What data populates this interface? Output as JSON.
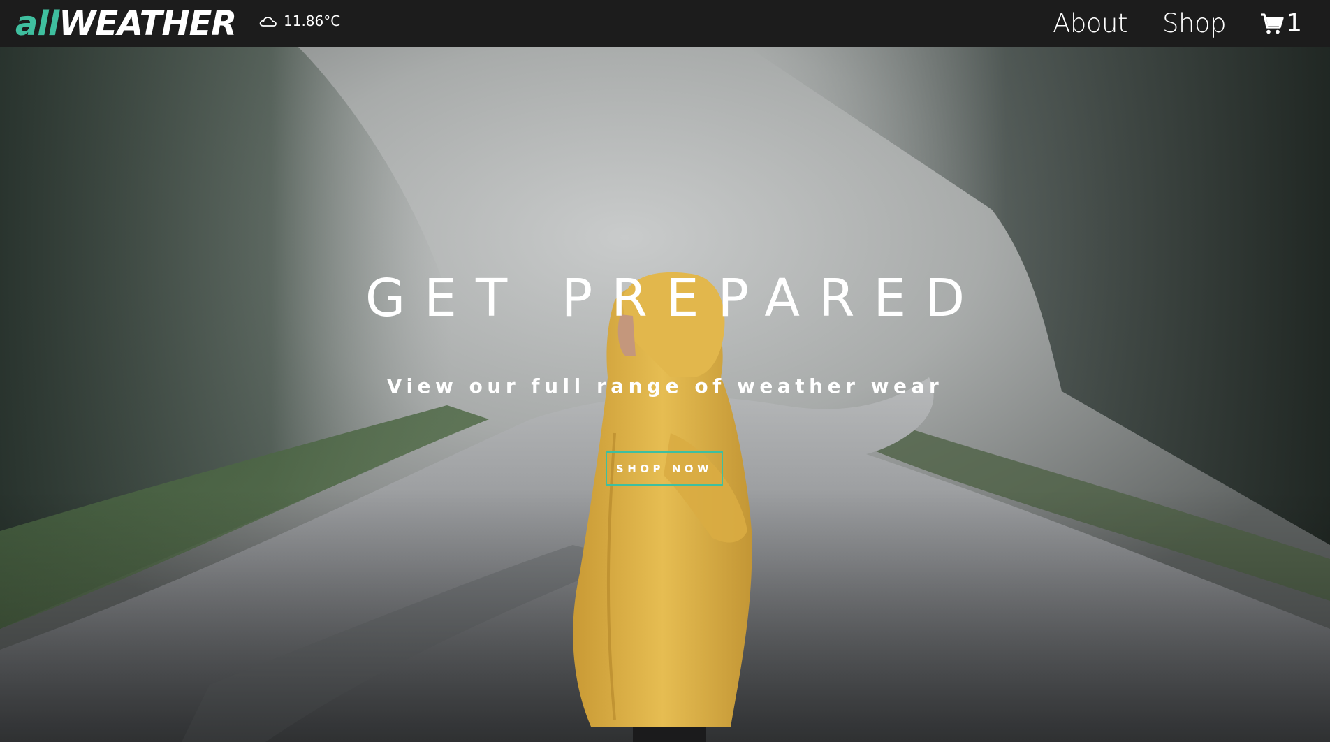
{
  "brand": {
    "prefix": "all",
    "name": "WEATHER",
    "accent_color": "#3fbf9f"
  },
  "weather": {
    "icon": "cloud-icon",
    "temperature": "11.86°C"
  },
  "nav": {
    "about_label": "About",
    "shop_label": "Shop",
    "cart_icon": "cart-icon",
    "cart_count": "1"
  },
  "hero": {
    "title": "GET PREPARED",
    "subtitle": "View our full range of weather wear",
    "cta_label": "SHOP NOW",
    "image": "misty-forest-road-yellow-raincoat"
  },
  "colors": {
    "navbar_bg": "#1c1c1c",
    "accent": "#3fbf9f",
    "text": "#ffffff",
    "raincoat": "#e3b64a"
  }
}
